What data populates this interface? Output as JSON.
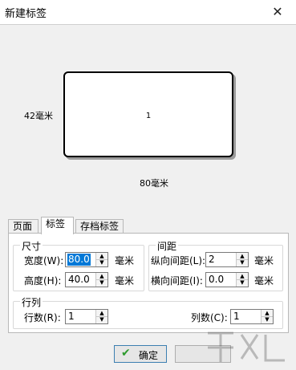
{
  "window": {
    "title": "新建标签",
    "close": "✕"
  },
  "preview": {
    "center_number": "1",
    "height_label": "42毫米",
    "width_label": "80毫米"
  },
  "tabs": [
    {
      "label": "页面",
      "active": false
    },
    {
      "label": "标签",
      "active": true
    },
    {
      "label": "存档标签",
      "active": false
    }
  ],
  "size": {
    "legend": "尺寸",
    "width_label": "宽度(W):",
    "width_value": "80.0",
    "height_label": "高度(H):",
    "height_value": "40.0",
    "unit": "毫米"
  },
  "spacing": {
    "legend": "间距",
    "vertical_label": "纵向间距(L):",
    "vertical_value": "2",
    "horizontal_label": "横向间距(I):",
    "horizontal_value": "0.0",
    "unit": "毫米"
  },
  "rows_cols": {
    "legend": "行列",
    "rows_label": "行数(R):",
    "rows_value": "1",
    "cols_label": "列数(C):",
    "cols_value": "1"
  },
  "buttons": {
    "ok": "确定"
  },
  "icons": {
    "ok": "checkmark-icon",
    "spin_up": "up-arrow-icon",
    "spin_down": "down-arrow-icon"
  }
}
